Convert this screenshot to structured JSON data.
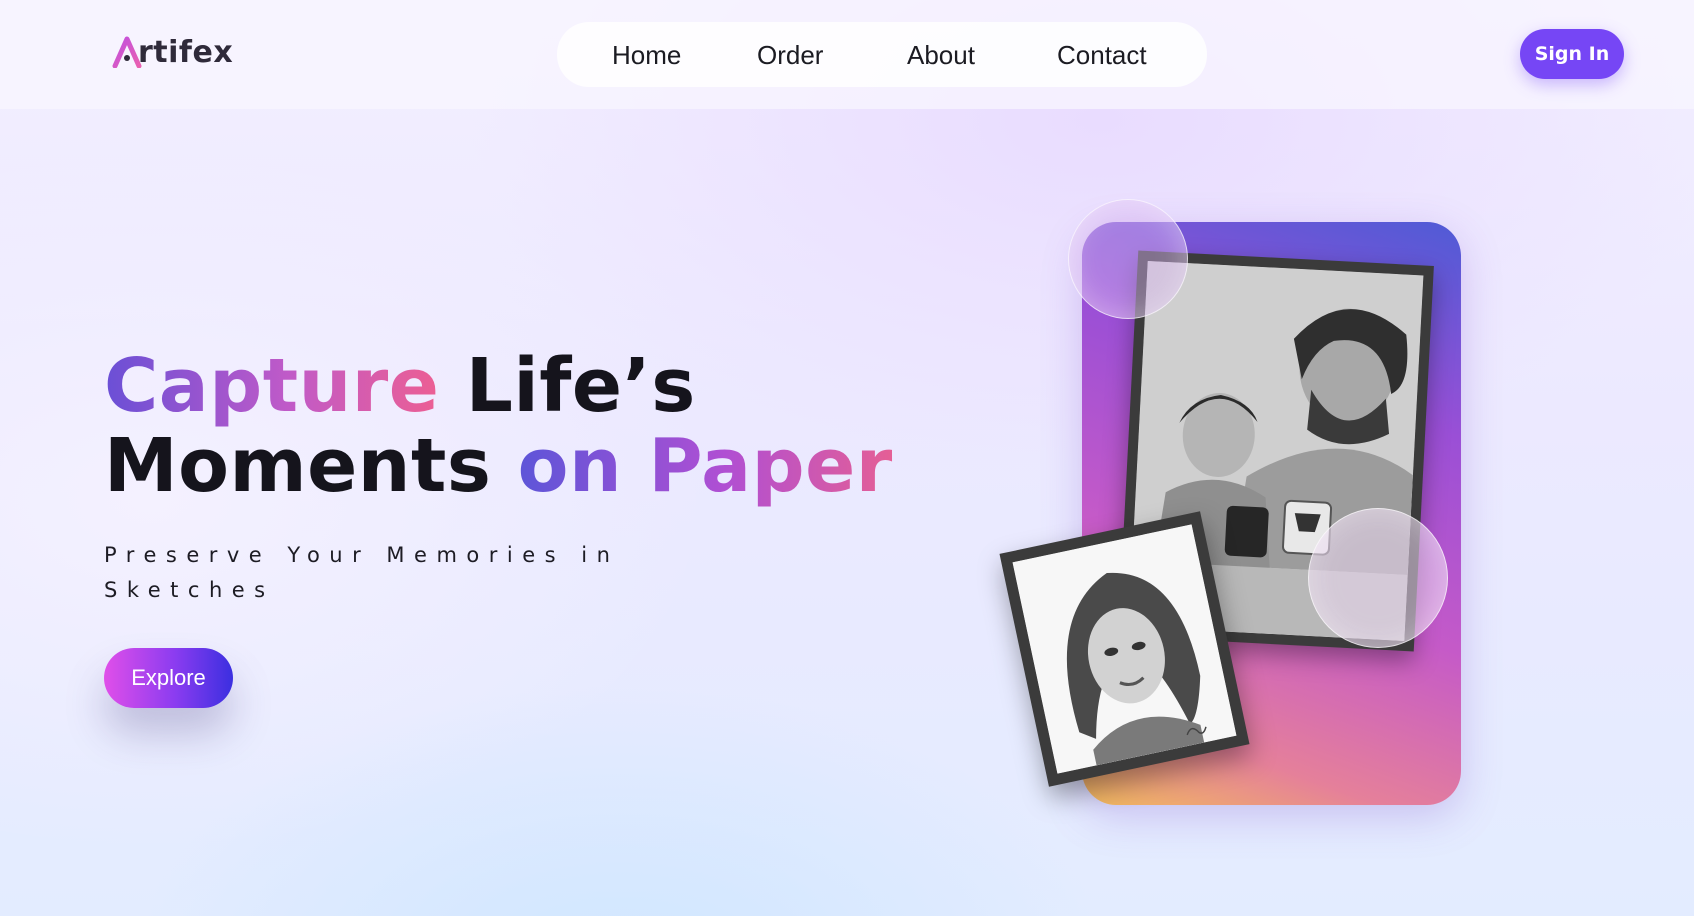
{
  "brand": {
    "name_prefix": "A",
    "name_rest": "rtifex"
  },
  "nav": {
    "items": [
      {
        "label": "Home"
      },
      {
        "label": "Order"
      },
      {
        "label": "About"
      },
      {
        "label": "Contact"
      }
    ]
  },
  "header": {
    "signin_label": "Sign In"
  },
  "hero": {
    "line1_gradient": "Capture",
    "line1_plain": "Life’s",
    "line2_plain": "Moments",
    "line2_gradient": "on Paper",
    "subtitle": "Preserve Your Memories in Sketches",
    "explore_label": "Explore"
  },
  "colors": {
    "accent": "#7646f5",
    "gradient_start": "#e04fe9",
    "gradient_end": "#3b2fe0",
    "heading_dark": "#15141c"
  }
}
